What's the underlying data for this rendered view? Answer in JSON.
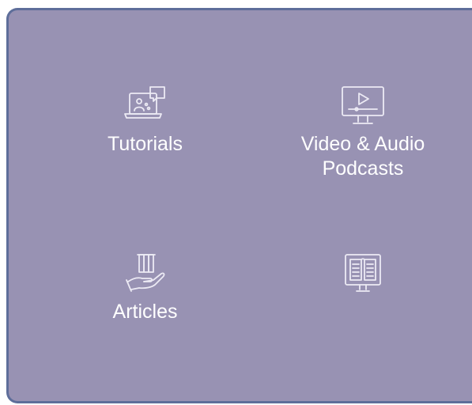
{
  "theme": {
    "panel_bg": "#9892b3",
    "panel_border": "#5e6e9a",
    "icon_stroke": "#eceaf4",
    "label_color": "#ffffff"
  },
  "tiles": [
    {
      "label": "Tutorials",
      "icon": "laptop-chat-icon"
    },
    {
      "label_line1": "Video & Audio",
      "label_line2": "Podcasts",
      "icon": "monitor-play-icon"
    },
    {
      "label": "Articles",
      "icon": "hand-books-icon"
    },
    {
      "label": "",
      "icon": "monitor-book-icon"
    }
  ]
}
